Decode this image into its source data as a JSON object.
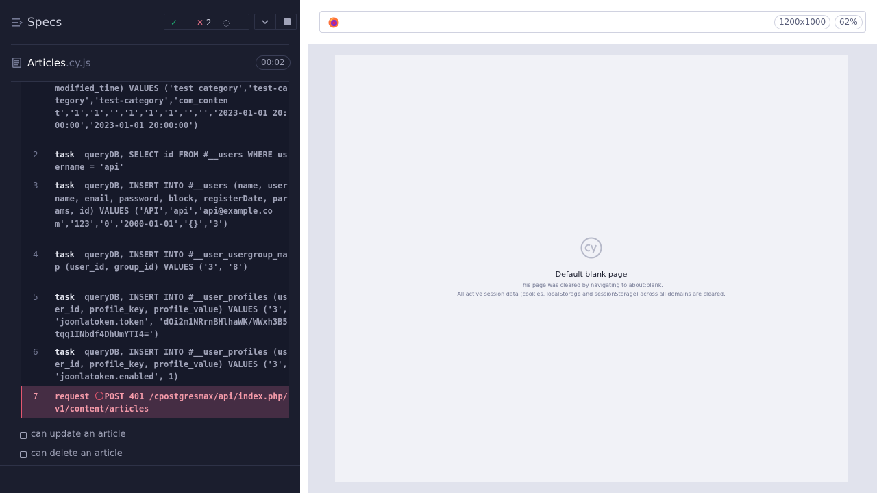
{
  "reporter": {
    "title": "Specs",
    "stats": {
      "passed": "--",
      "failed": "2",
      "pending": "--"
    },
    "file": {
      "name": "Articles",
      "ext": ".cy.js",
      "duration": "00:02"
    },
    "commands": [
      {
        "num": "",
        "name": "",
        "text": "modified_time) VALUES ('test category','test-category','test-category','com_content','1','1','','1','1','1','','','2023-01-01 20:00:00','2023-01-01 20:00:00')"
      },
      {
        "num": "2",
        "name": "task",
        "text": "queryDB, SELECT id FROM #__users WHERE username = 'api'"
      },
      {
        "num": "3",
        "name": "task",
        "text": "queryDB, INSERT INTO #__users (name, username, email, password, block, registerDate, params, id) VALUES ('API','api','api@example.com','123','0','2000-01-01','{}','3')"
      },
      {
        "num": "4",
        "name": "task",
        "text": "queryDB, INSERT INTO #__user_usergroup_map (user_id, group_id) VALUES ('3', '8')"
      },
      {
        "num": "5",
        "name": "task",
        "text": "queryDB, INSERT INTO #__user_profiles (user_id, profile_key, profile_value) VALUES ('3', 'joomlatoken.token', 'dOi2m1NRrnBHlhaWK/WWxh3B5tqq1INbdf4DhUmYTI4=')"
      },
      {
        "num": "6",
        "name": "task",
        "text": "queryDB, INSERT INTO #__user_profiles (user_id, profile_key, profile_value) VALUES ('3', 'joomlatoken.enabled', 1)"
      }
    ],
    "error_command": {
      "num": "7",
      "name": "request",
      "text": "POST 401 /cpostgresmax/api/index.php/v1/content/articles"
    },
    "tests": [
      {
        "label": "can update an article"
      },
      {
        "label": "can delete an article"
      }
    ]
  },
  "aut": {
    "viewport_size": "1200x1000",
    "zoom": "62%",
    "blank_page": {
      "title": "Default blank page",
      "line1": "This page was cleared by navigating to about:blank.",
      "line2": "All active session data (cookies, localStorage and sessionStorage) across all domains are cleared."
    }
  },
  "colors": {
    "reporter_bg": "#1b1e2e",
    "pass": "#1fa971",
    "fail": "#e45770",
    "aut_bg": "#e1e3ed"
  },
  "icons": [
    "list-icon",
    "check-icon",
    "x-icon",
    "spinner-icon",
    "chevron-down-icon",
    "stop-icon",
    "file-icon",
    "firefox-icon",
    "cypress-logo-icon",
    "error-circle-icon"
  ]
}
